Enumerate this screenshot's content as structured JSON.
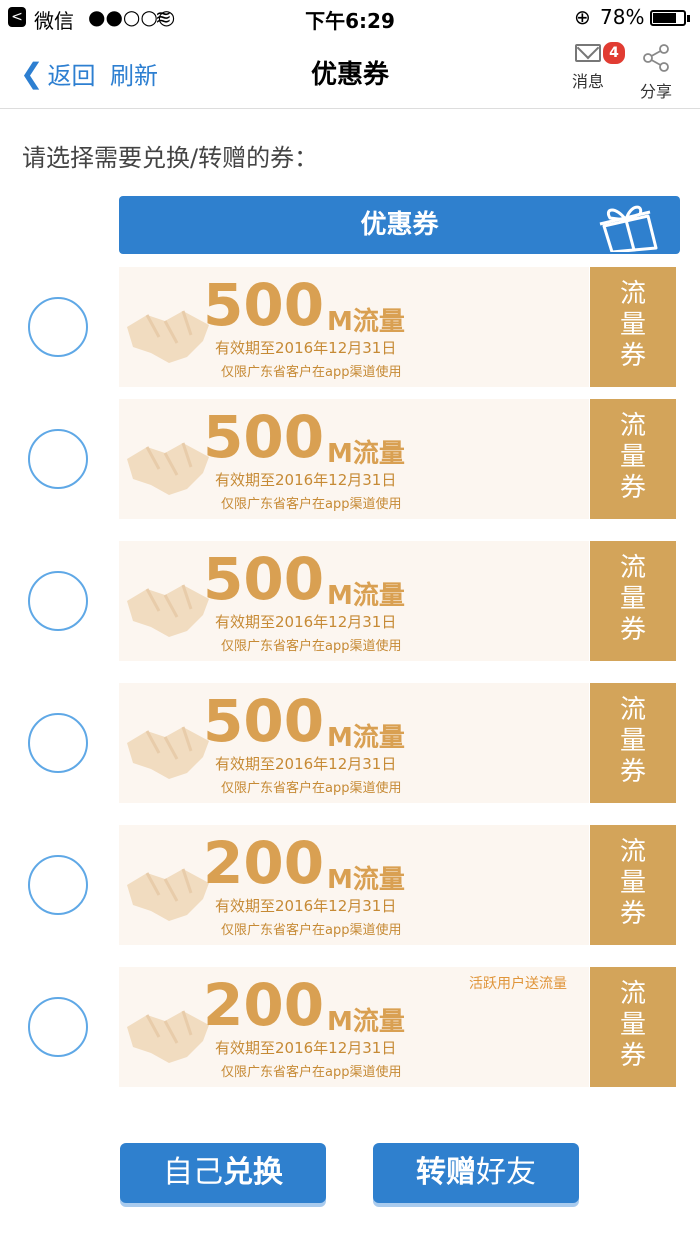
{
  "status_bar": {
    "back_glyph": "<",
    "carrier": "微信",
    "signal": "●●○○○",
    "wifi_glyph": "≋",
    "time": "下午6:29",
    "lock_glyph": "⊕",
    "battery_text": "78%",
    "battery_level": 0.78
  },
  "nav": {
    "back_label": "返回",
    "refresh_label": "刷新",
    "title": "优惠券",
    "message_label": "消息",
    "message_badge": "4",
    "share_label": "分享"
  },
  "prompt": "请选择需要兑换/转赠的券：",
  "coupon_header": "优惠券",
  "coupons": [
    {
      "amount": "500",
      "unit": "M流量",
      "validity": "有效期至2016年12月31日",
      "region": "仅限广东省客户在app渠道使用",
      "promo": "",
      "stub": [
        "流",
        "量",
        "券"
      ]
    },
    {
      "amount": "500",
      "unit": "M流量",
      "validity": "有效期至2016年12月31日",
      "region": "仅限广东省客户在app渠道使用",
      "promo": "",
      "stub": [
        "流",
        "量",
        "券"
      ]
    },
    {
      "amount": "500",
      "unit": "M流量",
      "validity": "有效期至2016年12月31日",
      "region": "仅限广东省客户在app渠道使用",
      "promo": "",
      "stub": [
        "流",
        "量",
        "券"
      ]
    },
    {
      "amount": "500",
      "unit": "M流量",
      "validity": "有效期至2016年12月31日",
      "region": "仅限广东省客户在app渠道使用",
      "promo": "",
      "stub": [
        "流",
        "量",
        "券"
      ]
    },
    {
      "amount": "200",
      "unit": "M流量",
      "validity": "有效期至2016年12月31日",
      "region": "仅限广东省客户在app渠道使用",
      "promo": "",
      "stub": [
        "流",
        "量",
        "券"
      ]
    },
    {
      "amount": "200",
      "unit": "M流量",
      "validity": "有效期至2016年12月31日",
      "region": "仅限广东省客户在app渠道使用",
      "promo": "活跃用户送流量",
      "stub": [
        "流",
        "量",
        "券"
      ]
    }
  ],
  "buttons": {
    "self_light": "自己",
    "self_bold": "兑换",
    "gift_bold": "转赠",
    "gift_light": "好友"
  },
  "colors": {
    "primary_blue": "#2f80ce",
    "gold": "#d9a052",
    "stub": "#d3a45a",
    "card_bg": "#fcf6f0"
  }
}
